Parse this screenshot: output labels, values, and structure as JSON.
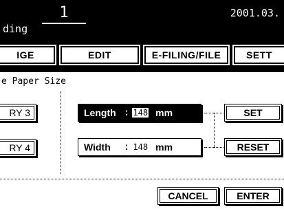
{
  "header": {
    "counter": "1",
    "date": "2001.03.",
    "subtitle": "ding"
  },
  "tabs": [
    {
      "label": "ІGE"
    },
    {
      "label": "EDIT"
    },
    {
      "label": "E-FILING/FILE"
    },
    {
      "label": "SETT"
    }
  ],
  "panel": {
    "title": "e Paper Size",
    "tray_buttons": [
      {
        "label": "RY 3"
      },
      {
        "label": "RY 4"
      }
    ],
    "length": {
      "label": "Length",
      "colon": ":",
      "value": "148",
      "unit": "mm"
    },
    "width": {
      "label": "Width",
      "colon": ":",
      "value": "148",
      "unit": "mm"
    },
    "set_label": "SET",
    "reset_label": "RESET"
  },
  "footer": {
    "cancel_label": "CANCEL",
    "enter_label": "ENTER"
  }
}
